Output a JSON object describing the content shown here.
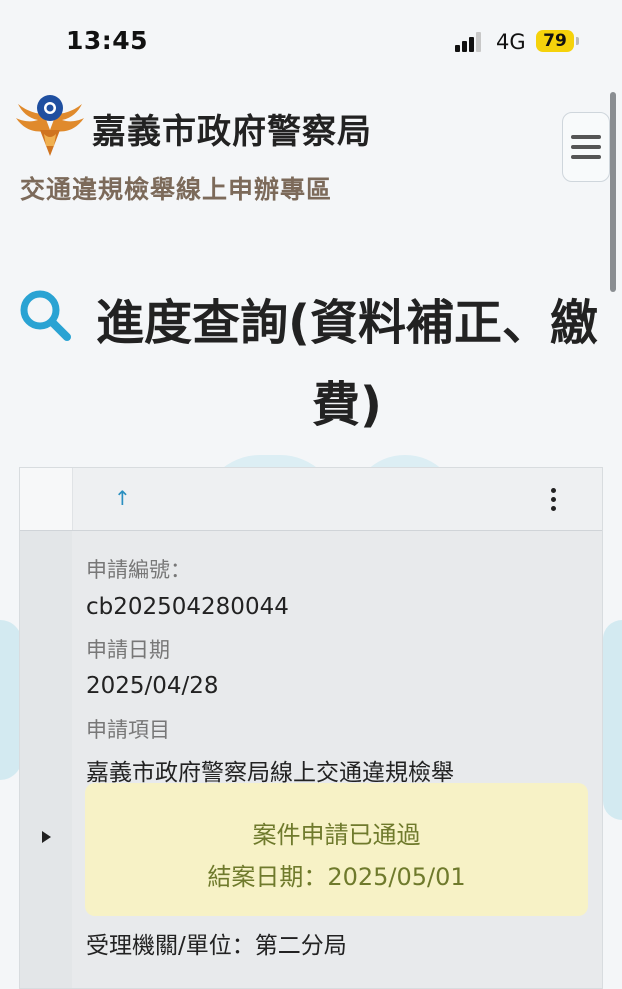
{
  "status_bar": {
    "time": "13:45",
    "network": "4G",
    "battery": "79"
  },
  "header": {
    "title": "嘉義市政府警察局",
    "subtitle": "交通違規檢舉線上申辦專區"
  },
  "page": {
    "heading": "進度查詢(資料補正、繳費)"
  },
  "table": {
    "sort_arrow": "↑"
  },
  "record": {
    "application_no_label": "申請編號：",
    "application_no": "cb202504280044",
    "date_label": "申請日期",
    "date": "2025/04/28",
    "item_label": "申請項目",
    "item": "嘉義市政府警察局線上交通違規檢舉",
    "status": "案件申請已通過",
    "close_date": "結案日期：2025/05/01",
    "agency": "受理機關/單位：第二分局"
  },
  "colors": {
    "accent": "#2a8fc0",
    "status_bg": "#f7f2c6",
    "status_text": "#6f7a2c"
  },
  "icons": [
    "police-emblem",
    "menu-icon",
    "search-icon",
    "more-vertical-icon",
    "expand-arrow-icon"
  ]
}
